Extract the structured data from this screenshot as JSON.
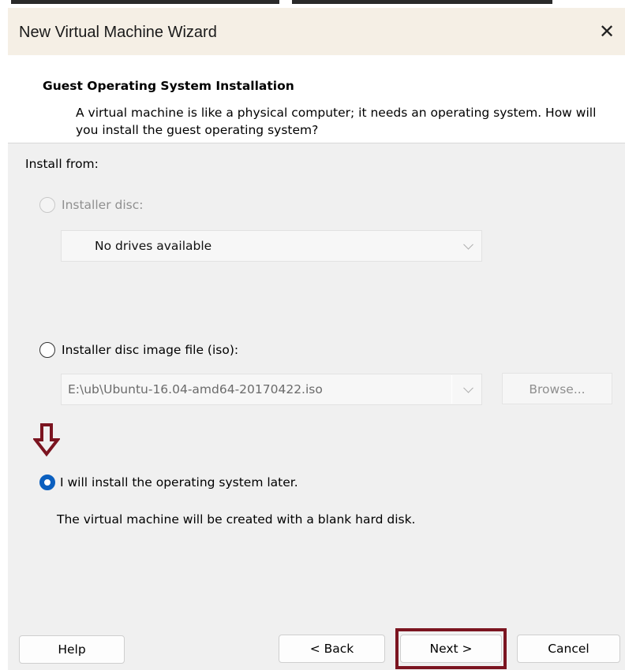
{
  "window": {
    "title": "New Virtual Machine Wizard",
    "close_glyph": "✕"
  },
  "header": {
    "title": "Guest Operating System Installation",
    "description": "A virtual machine is like a physical computer; it needs an operating system. How will you install the guest operating system?"
  },
  "install_from": {
    "label": "Install from:",
    "options": [
      {
        "id": "installer-disc",
        "label": "Installer disc:",
        "selected": false,
        "enabled": false,
        "combo_value": "No drives available"
      },
      {
        "id": "iso",
        "label": "Installer disc image file (iso):",
        "selected": false,
        "enabled": true,
        "combo_value": "E:\\ub\\Ubuntu-16.04-amd64-20170422.iso",
        "browse_label": "Browse..."
      },
      {
        "id": "later",
        "label": "I will install the operating system later.",
        "selected": true,
        "enabled": true,
        "description": "The virtual machine will be created with a blank hard disk."
      }
    ]
  },
  "annotation": {
    "arrow_icon": "down-arrow-icon",
    "highlight_color": "#7b1420"
  },
  "footer": {
    "help_label": "Help",
    "back_label": "< Back",
    "next_label": "Next >",
    "cancel_label": "Cancel"
  },
  "colors": {
    "titlebar": "#f5efe5",
    "radio_selected": "#0a5fbf",
    "disabled_text": "#8f8f8f"
  }
}
